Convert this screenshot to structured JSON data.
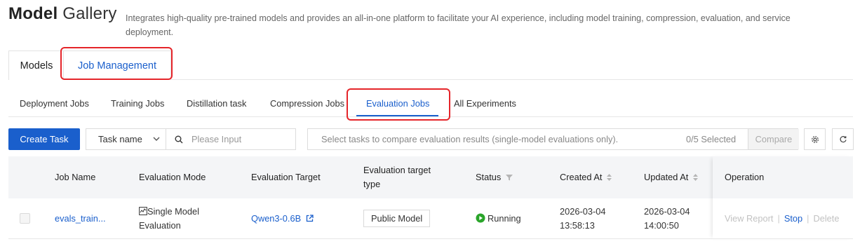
{
  "header": {
    "title_bold": "Model",
    "title_light": "Gallery",
    "subtitle": "Integrates high-quality pre-trained models and provides an all-in-one platform to facilitate your AI experience, including model training, compression, evaluation, and service deployment."
  },
  "top_tabs": [
    {
      "label": "Models"
    },
    {
      "label": "Job Management",
      "active": true
    }
  ],
  "sub_tabs": [
    {
      "label": "Deployment Jobs"
    },
    {
      "label": "Training Jobs"
    },
    {
      "label": "Distillation task"
    },
    {
      "label": "Compression Jobs"
    },
    {
      "label": "Evaluation Jobs",
      "active": true
    },
    {
      "label": "All Experiments"
    }
  ],
  "toolbar": {
    "create_label": "Create Task",
    "filter_select": "Task name",
    "search_placeholder": "Please Input",
    "compare_hint": "Select tasks to compare evaluation results (single-model evaluations only).",
    "compare_count": "0/5 Selected",
    "compare_label": "Compare"
  },
  "table": {
    "columns": {
      "job_name": "Job Name",
      "evaluation_mode": "Evaluation Mode",
      "evaluation_target": "Evaluation Target",
      "target_type": "Evaluation target type",
      "status": "Status",
      "created_at": "Created At",
      "updated_at": "Updated At",
      "operation": "Operation"
    },
    "rows": [
      {
        "job_name": "evals_train...",
        "evaluation_mode": "Single Model Evaluation",
        "evaluation_target": "Qwen3-0.6B",
        "target_type": "Public Model",
        "status": "Running",
        "created_date": "2026-03-04",
        "created_time": "13:58:13",
        "updated_date": "2026-03-04",
        "updated_time": "14:00:50",
        "ops": {
          "view_report": "View Report",
          "stop": "Stop",
          "delete": "Delete"
        }
      }
    ]
  },
  "colors": {
    "accent": "#1a5fcc",
    "highlight": "#e5252a",
    "running": "#2aa52a"
  }
}
